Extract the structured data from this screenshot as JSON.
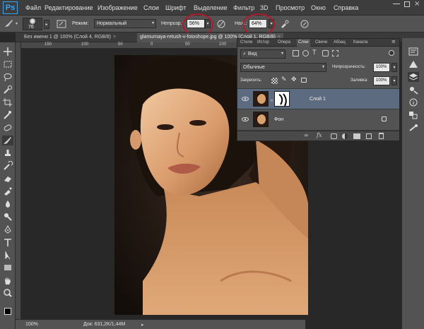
{
  "app": {
    "logo": "Ps"
  },
  "menu": [
    "Файл",
    "Редактирование",
    "Изображение",
    "Слои",
    "Шрифт",
    "Выделение",
    "Фильтр",
    "3D",
    "Просмотр",
    "Окно",
    "Справка"
  ],
  "options": {
    "brush_size": "76",
    "mode_label": "Режим:",
    "mode_value": "Нормальный",
    "opacity_label": "Непрозр.:",
    "opacity_value": "56%",
    "flow_label": "Наж.:",
    "flow_value": "64%"
  },
  "tabs": [
    {
      "label": "Без имени 1 @ 100% (Слой 4, RGB/8)",
      "close": "×",
      "active": false
    },
    {
      "label": "glamurnaya-retush-v-fotoshope.jpg @ 100% (Слой 1, RGB/8)",
      "close": "×",
      "active": true
    }
  ],
  "ruler_numbers": [
    "150",
    "100",
    "50",
    "0",
    "50",
    "100"
  ],
  "status": {
    "zoom": "100%",
    "doc": "Док: 631,2K/1,44M"
  },
  "layers_panel": {
    "tabs": [
      "Стили",
      "Истор",
      "Опера",
      "Слои",
      "Свиче",
      "Абзац",
      "Канала"
    ],
    "active_tab": "Слои",
    "filter_kind": "Вид",
    "blend_mode": "Обычные",
    "opacity_label": "Непрозрачность:",
    "opacity_value": "100%",
    "lock_label": "Закрепить:",
    "fill_label": "Заливка:",
    "fill_value": "100%",
    "layers": [
      {
        "name": "Слой 1",
        "selected": true
      },
      {
        "name": "Фон",
        "selected": false
      }
    ]
  },
  "icons": {
    "brush": "brush-icon",
    "eye": "eye-icon",
    "lock": "lock-icon"
  },
  "colors": {
    "accent": "#31a8ff",
    "annotation_circle": "#b01a2c",
    "selected_layer": "#5d6b80"
  }
}
